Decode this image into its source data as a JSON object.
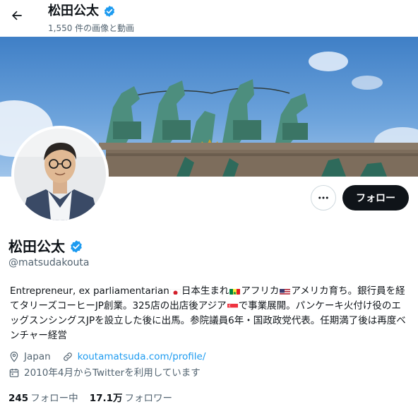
{
  "header": {
    "name": "松田公太",
    "media_count": "1,550 件の画像と動画"
  },
  "profile": {
    "name": "松田公太",
    "handle": "@matsudakouta",
    "verified_color": "#1d9bf0",
    "more_icon": "more-icon",
    "follow_label": "フォロー"
  },
  "bio": {
    "seg1": "Entrepreneur, ex parliamentarian",
    "seg2": "日本生まれ",
    "seg3": "アフリカ",
    "seg4": "アメリカ育ち。銀行員を経てタリーズコーヒーJP創業。325店の出店後アジア",
    "seg5": "で事業展開。パンケーキ火付け役のエッグスンシングスJPを設立した後に出馬。参院議員6年・国政政党代表。任期満了後は再度ベンチャー経営"
  },
  "meta": {
    "location": "Japan",
    "website": "koutamatsuda.com/profile/",
    "joined": "2010年4月からTwitterを利用しています"
  },
  "stats": {
    "following_count": "245",
    "following_label": "フォロー中",
    "followers_count": "17.1万",
    "followers_label": "フォロワー"
  }
}
